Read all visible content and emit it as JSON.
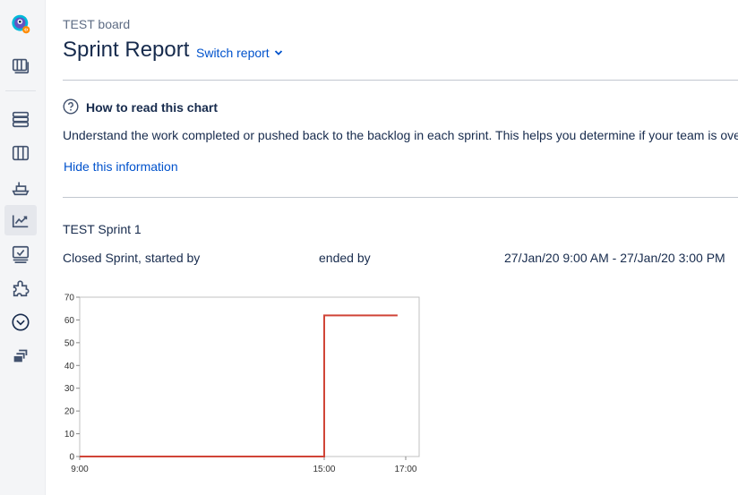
{
  "sidebar": {
    "items": [
      {
        "icon": "project-avatar-icon"
      },
      {
        "icon": "board-icon"
      },
      {
        "icon": "backlog-icon"
      },
      {
        "icon": "active-sprints-icon"
      },
      {
        "icon": "releases-icon"
      },
      {
        "icon": "reports-icon",
        "active": true
      },
      {
        "icon": "issues-icon"
      },
      {
        "icon": "components-icon"
      },
      {
        "icon": "add-item-icon"
      },
      {
        "icon": "pages-icon"
      }
    ]
  },
  "header": {
    "board_name": "TEST board",
    "title": "Sprint Report",
    "switch_label": "Switch report"
  },
  "help": {
    "title": "How to read this chart",
    "description": "Understand the work completed or pushed back to the backlog in each sprint. This helps you determine if your team is ove",
    "hide_link": "Hide this information"
  },
  "sprint": {
    "name": "TEST Sprint 1",
    "status": "Closed Sprint, started by",
    "ended": "ended by",
    "dates": "27/Jan/20 9:00 AM - 27/Jan/20 3:00 PM"
  },
  "colors": {
    "accent": "#0052cc",
    "line": "#d04437"
  },
  "chart_data": {
    "type": "line",
    "x_ticks": [
      "9:00",
      "15:00",
      "17:00"
    ],
    "y_ticks": [
      0,
      10,
      20,
      30,
      40,
      50,
      60,
      70
    ],
    "ylim": [
      0,
      70
    ],
    "xlim_hours": [
      9,
      17.33
    ],
    "series": [
      {
        "x": [
          9,
          15.0,
          15.0,
          16.8
        ],
        "y": [
          0,
          0,
          62,
          62
        ]
      }
    ]
  }
}
